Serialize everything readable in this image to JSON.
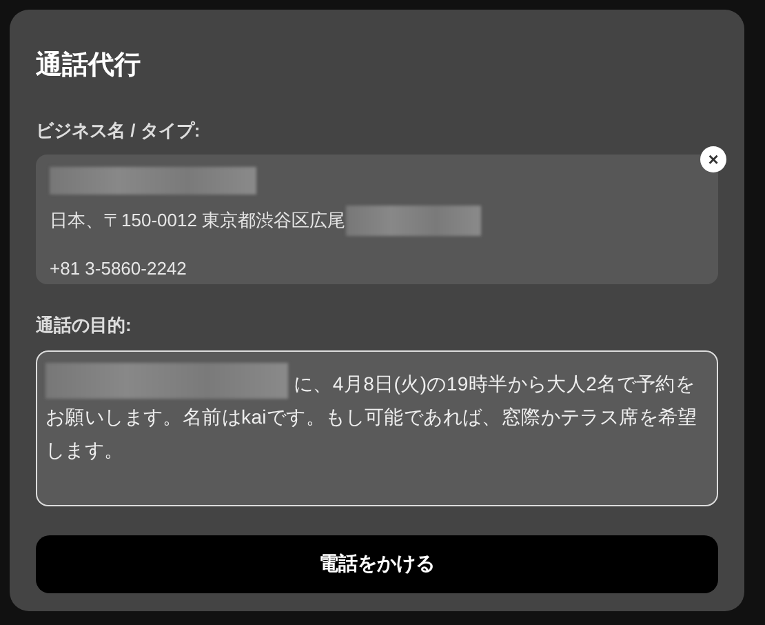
{
  "dialog": {
    "title": "通話代行"
  },
  "business": {
    "label": "ビジネス名 / タイプ:",
    "name_redacted": true,
    "address": "日本、〒150-0012 東京都渋谷区広尾",
    "address_redacted": true,
    "phone": "+81 3-5860-2242",
    "close": "×"
  },
  "purpose": {
    "label": "通話の目的:",
    "prefix_redacted": true,
    "text": "に、4月8日(火)の19時半から大人2名で予約をお願いします。名前はkaiです。もし可能であれば、窓際かテラス席を希望します。"
  },
  "call_button": "電話をかける"
}
